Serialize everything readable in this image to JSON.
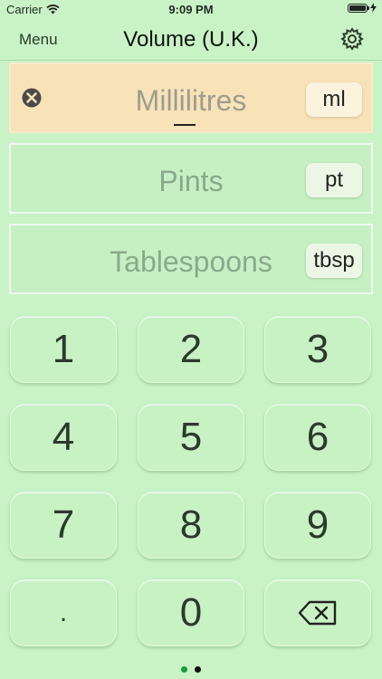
{
  "status": {
    "carrier": "Carrier",
    "time": "9:09 PM"
  },
  "nav": {
    "menu_label": "Menu",
    "title": "Volume (U.K.)",
    "settings_icon": "gear-icon"
  },
  "fields": [
    {
      "label": "Millilitres",
      "unit": "ml",
      "active": true
    },
    {
      "label": "Pints",
      "unit": "pt",
      "active": false
    },
    {
      "label": "Tablespoons",
      "unit": "tbsp",
      "active": false
    }
  ],
  "keypad": {
    "keys": [
      "1",
      "2",
      "3",
      "4",
      "5",
      "6",
      "7",
      "8",
      "9",
      ".",
      "0"
    ],
    "backspace_icon": "backspace-icon"
  },
  "pagination": {
    "count": 2,
    "current": 1
  },
  "colors": {
    "background": "#c9f3c6",
    "active_field": "#f8e2b8",
    "page_dot_active": "#1a9a3a"
  }
}
